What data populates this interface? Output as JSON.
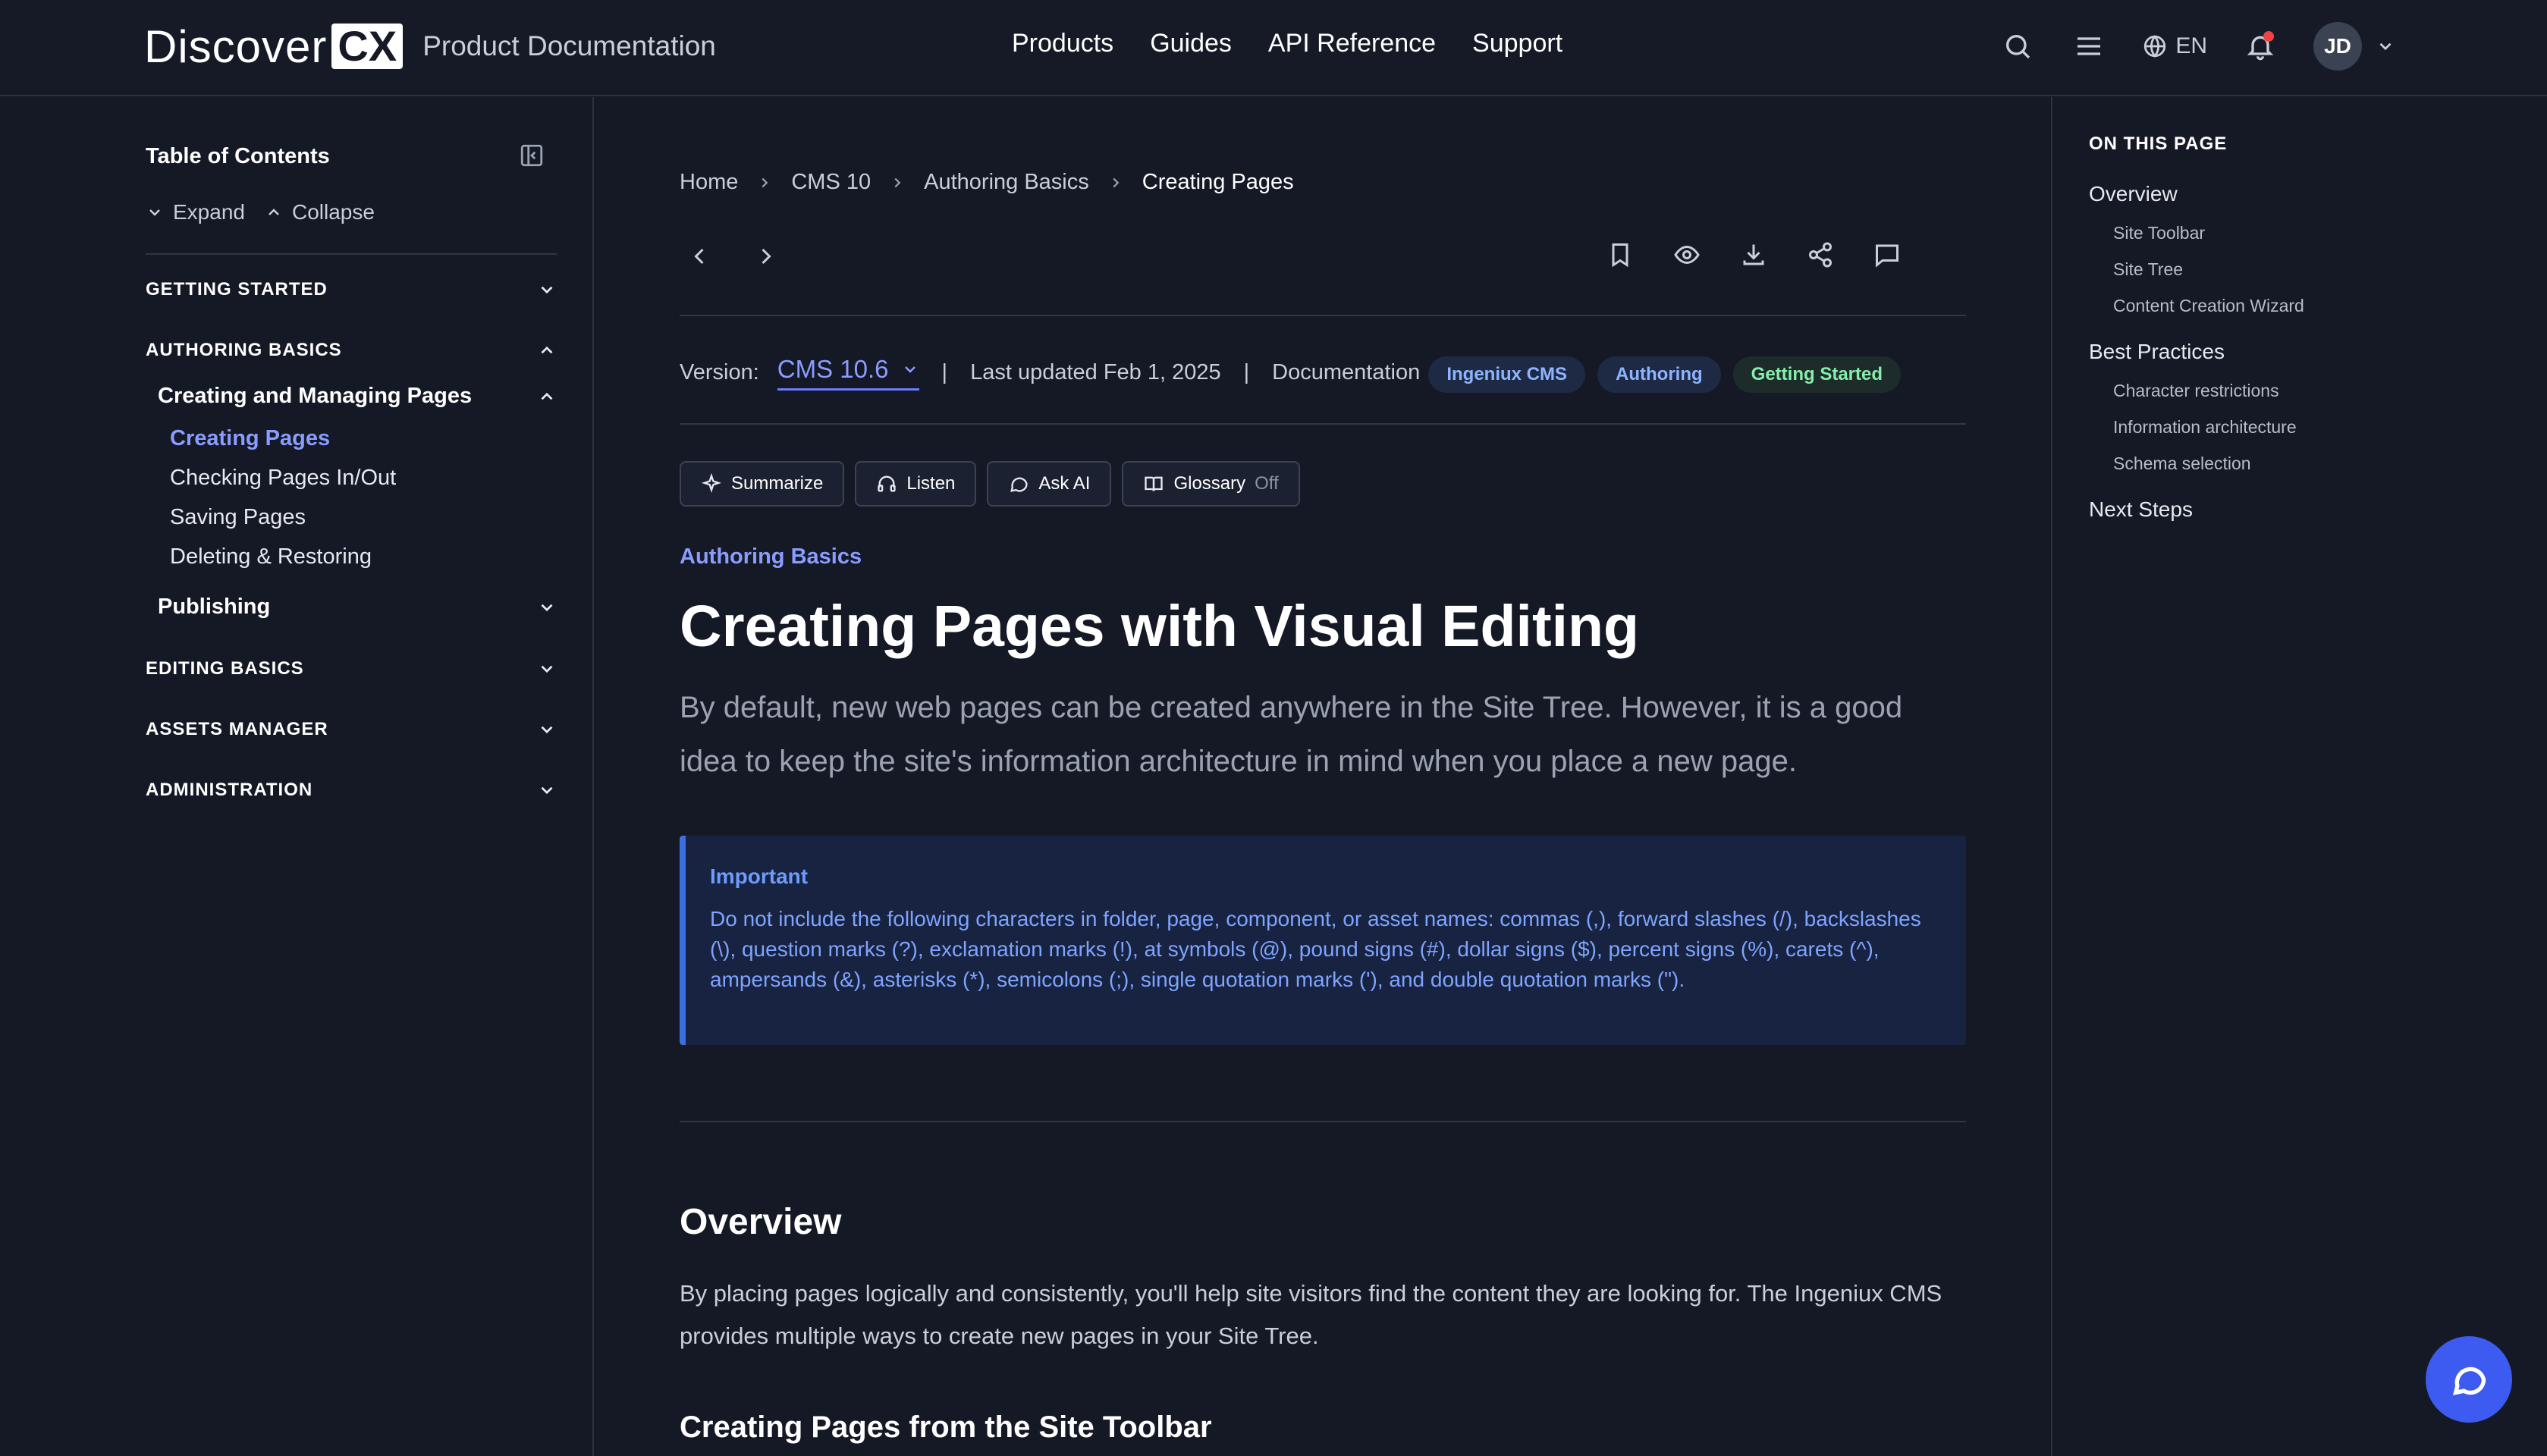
{
  "header": {
    "logo_word": "Discover",
    "logo_mark": "CX",
    "subtitle": "Product Documentation",
    "nav": [
      "Products",
      "Guides",
      "API Reference",
      "Support"
    ],
    "language": "EN",
    "avatar_initials": "JD",
    "icons": [
      "search-icon",
      "menu-icon",
      "globe-icon",
      "bell-icon",
      "chevron-down-icon"
    ]
  },
  "sidebar": {
    "title": "Table of Contents",
    "expand_label": "Expand",
    "collapse_label": "Collapse",
    "sections": {
      "getting_started": "GETTING STARTED",
      "authoring_basics": "AUTHORING BASICS",
      "editing_basics": "EDITING BASICS",
      "assets_manager": "ASSETS MANAGER",
      "administration": "ADMINISTRATION"
    },
    "sub": {
      "creating_managing": "Creating and Managing Pages",
      "publishing": "Publishing"
    },
    "leaves": [
      "Creating Pages",
      "Checking Pages In/Out",
      "Saving Pages",
      "Deleting & Restoring"
    ]
  },
  "main": {
    "breadcrumb": [
      "Home",
      "CMS 10",
      "Authoring Basics",
      "Creating Pages"
    ],
    "version_label": "Version:",
    "version_value": "CMS 10.6",
    "separator": "|",
    "last_updated": "Last updated Feb 1, 2025",
    "doc_type": "Documentation",
    "tags": [
      "Ingeniux CMS",
      "Authoring",
      "Getting Started"
    ],
    "tools": {
      "summarize": "Summarize",
      "listen": "Listen",
      "ask_ai": "Ask AI",
      "glossary": "Glossary",
      "glossary_state": "Off"
    },
    "eyebrow": "Authoring Basics",
    "title": "Creating Pages with Visual Editing",
    "lead": "By default, new web pages can be created anywhere in the Site Tree. However, it is a good idea to keep the site's information architecture in mind when you place a new page.",
    "callout": {
      "title": "Important",
      "body": "Do not include the following characters in folder, page, component, or asset names: commas (,), forward slashes (/), backslashes (\\), question marks (?), exclamation marks (!), at symbols (@), pound signs (#), dollar signs ($), percent signs (%), carets (^), ampersands (&), asterisks (*), semicolons (;), single quotation marks ('), and double quotation marks (\")."
    },
    "overview_heading": "Overview",
    "overview_text": "By placing pages logically and consistently, you'll help site visitors find the content they are looking for. The Ingeniux CMS provides multiple ways to create new pages in your Site Tree.",
    "next_heading": "Creating Pages from the Site Toolbar"
  },
  "rail": {
    "title": "ON THIS PAGE",
    "overview": "Overview",
    "overview_items": [
      "Site Toolbar",
      "Site Tree",
      "Content Creation Wizard"
    ],
    "best_practices": "Best Practices",
    "best_items": [
      "Character restrictions",
      "Information architecture",
      "Schema selection"
    ],
    "next_steps": "Next Steps"
  },
  "colors": {
    "background": "#141925",
    "accent": "#8b9cff",
    "callout_bg": "#172340",
    "callout_border": "#3b6fe0",
    "tag_green": "#86efac",
    "fab": "#3d5af1"
  }
}
